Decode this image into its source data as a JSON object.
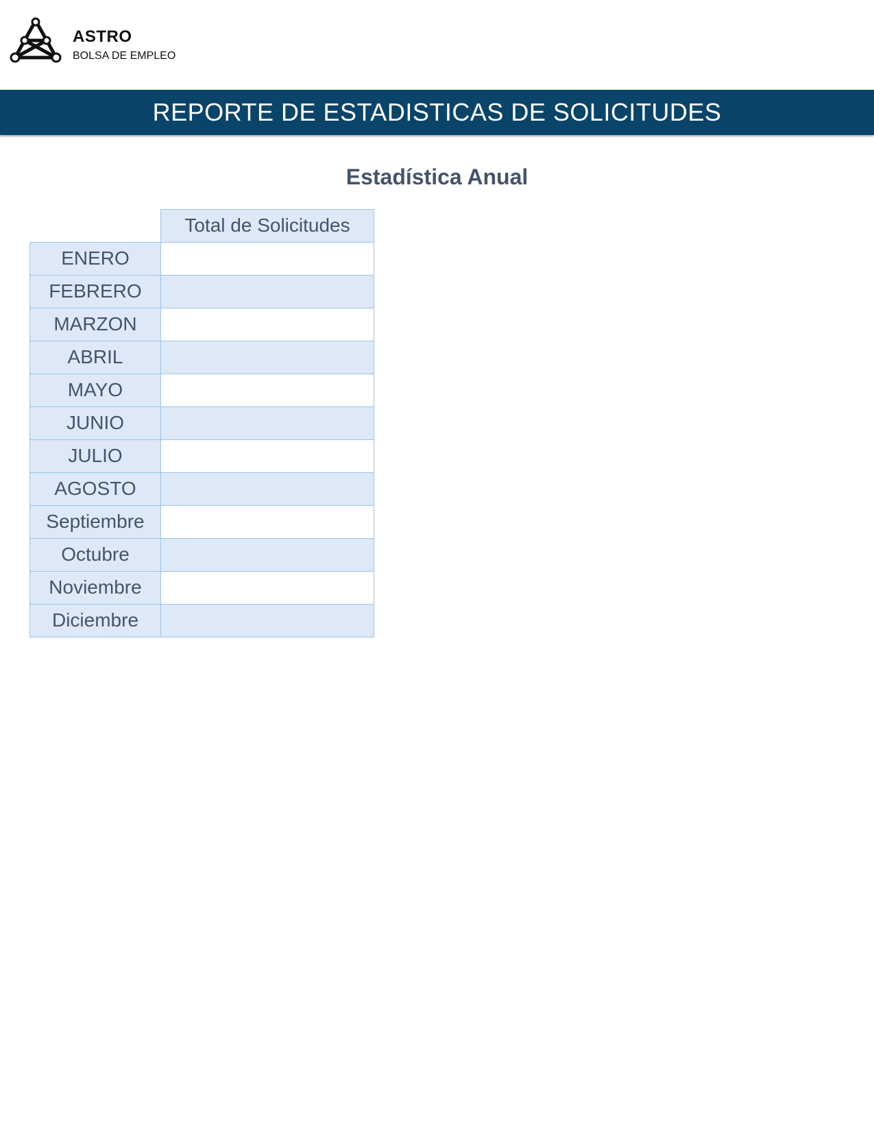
{
  "logo": {
    "icon": "astro-a-icon",
    "name": "ASTRO",
    "subtitle": "BOLSA DE EMPLEO"
  },
  "banner": {
    "title": "REPORTE DE ESTADISTICAS DE SOLICITUDES"
  },
  "section": {
    "title": "Estadística Anual"
  },
  "table": {
    "column_header": "Total de Solicitudes",
    "rows": [
      {
        "month": "ENERO",
        "value": ""
      },
      {
        "month": "FEBRERO",
        "value": ""
      },
      {
        "month": "MARZON",
        "value": ""
      },
      {
        "month": "ABRIL",
        "value": ""
      },
      {
        "month": "MAYO",
        "value": ""
      },
      {
        "month": "JUNIO",
        "value": ""
      },
      {
        "month": "JULIO",
        "value": ""
      },
      {
        "month": "AGOSTO",
        "value": ""
      },
      {
        "month": "Septiembre",
        "value": ""
      },
      {
        "month": "Octubre",
        "value": ""
      },
      {
        "month": "Noviembre",
        "value": ""
      },
      {
        "month": "Diciembre",
        "value": ""
      }
    ]
  },
  "colors": {
    "banner": "#0b4469",
    "text": "#44546a",
    "table_fill": "#dde9f6",
    "table_border": "#9ec3e6"
  }
}
